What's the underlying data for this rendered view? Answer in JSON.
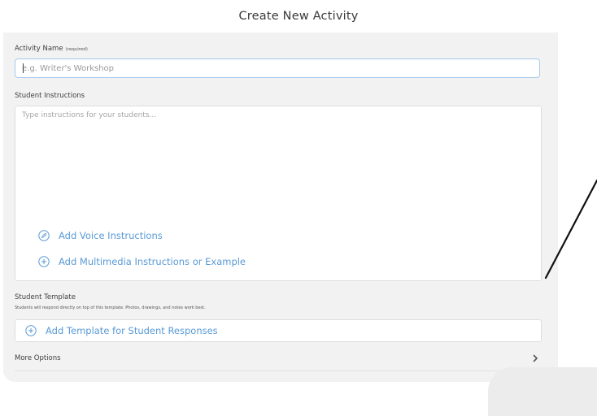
{
  "header": {
    "title": "Create New Activity"
  },
  "form": {
    "activity_name": {
      "label": "Activity Name",
      "required_note": "(required)",
      "placeholder": "e.g. Writer's Workshop",
      "value": ""
    },
    "student_instructions": {
      "label": "Student Instructions",
      "placeholder": "Type instructions for your students...",
      "value": "",
      "add_voice_label": "Add Voice Instructions",
      "add_multimedia_label": "Add Multimedia Instructions or Example"
    },
    "student_template": {
      "label": "Student Template",
      "hint": "Students will respond directly on top of this template. Photos, drawings, and notes work best.",
      "add_template_label": "Add Template for Student Responses"
    },
    "more_options": {
      "label": "More Options"
    }
  },
  "colors": {
    "accent": "#5a9ad6",
    "panel_bg": "#f2f2f3",
    "input_focus_border": "#a6c8ec"
  },
  "icons": {
    "voice": "pencil-circle-icon",
    "multimedia": "plus-circle-icon",
    "template": "plus-circle-icon",
    "more_options": "chevron-right-icon"
  }
}
